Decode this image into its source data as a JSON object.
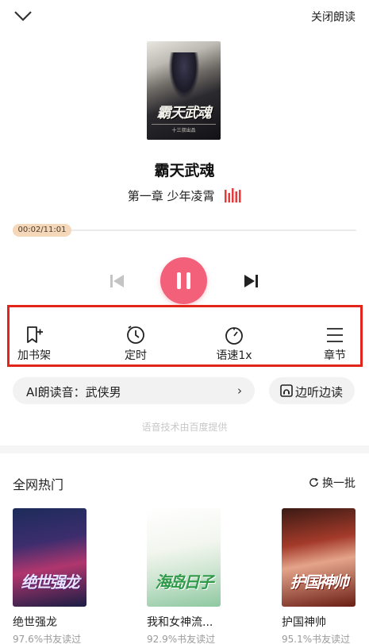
{
  "header": {
    "close_label": "关闭朗读"
  },
  "book": {
    "title": "霸天武魂",
    "chapter": "第一章 少年凌霄",
    "cover_art_title": "霸天武魂",
    "cover_art_author": "十三叔出品"
  },
  "player": {
    "time": "00:02/11:01",
    "progress": 0.003,
    "state": "playing"
  },
  "controls": {
    "shelf": "加书架",
    "timer": "定时",
    "speed": "语速1x",
    "chapters": "章节"
  },
  "voice": {
    "label": "AI朗读音：武侠男",
    "chevron": "›"
  },
  "listen_read": {
    "label": "边听边读"
  },
  "provider_note": "语音技术由百度提供",
  "hot": {
    "title": "全网热门",
    "refresh_label": "换一批",
    "books": [
      {
        "name": "绝世强龙",
        "stat": "97.6%书友读过",
        "art": "绝世强龙"
      },
      {
        "name": "我和女神流...",
        "stat": "92.9%书友读过",
        "art": "海岛日子"
      },
      {
        "name": "护国神帅",
        "stat": "95.1%书友读过",
        "art": "护国神帅"
      }
    ]
  },
  "colors": {
    "accent": "#f3607a",
    "highlight_border": "#e1251b",
    "time_badge": "#f5d7b9"
  }
}
